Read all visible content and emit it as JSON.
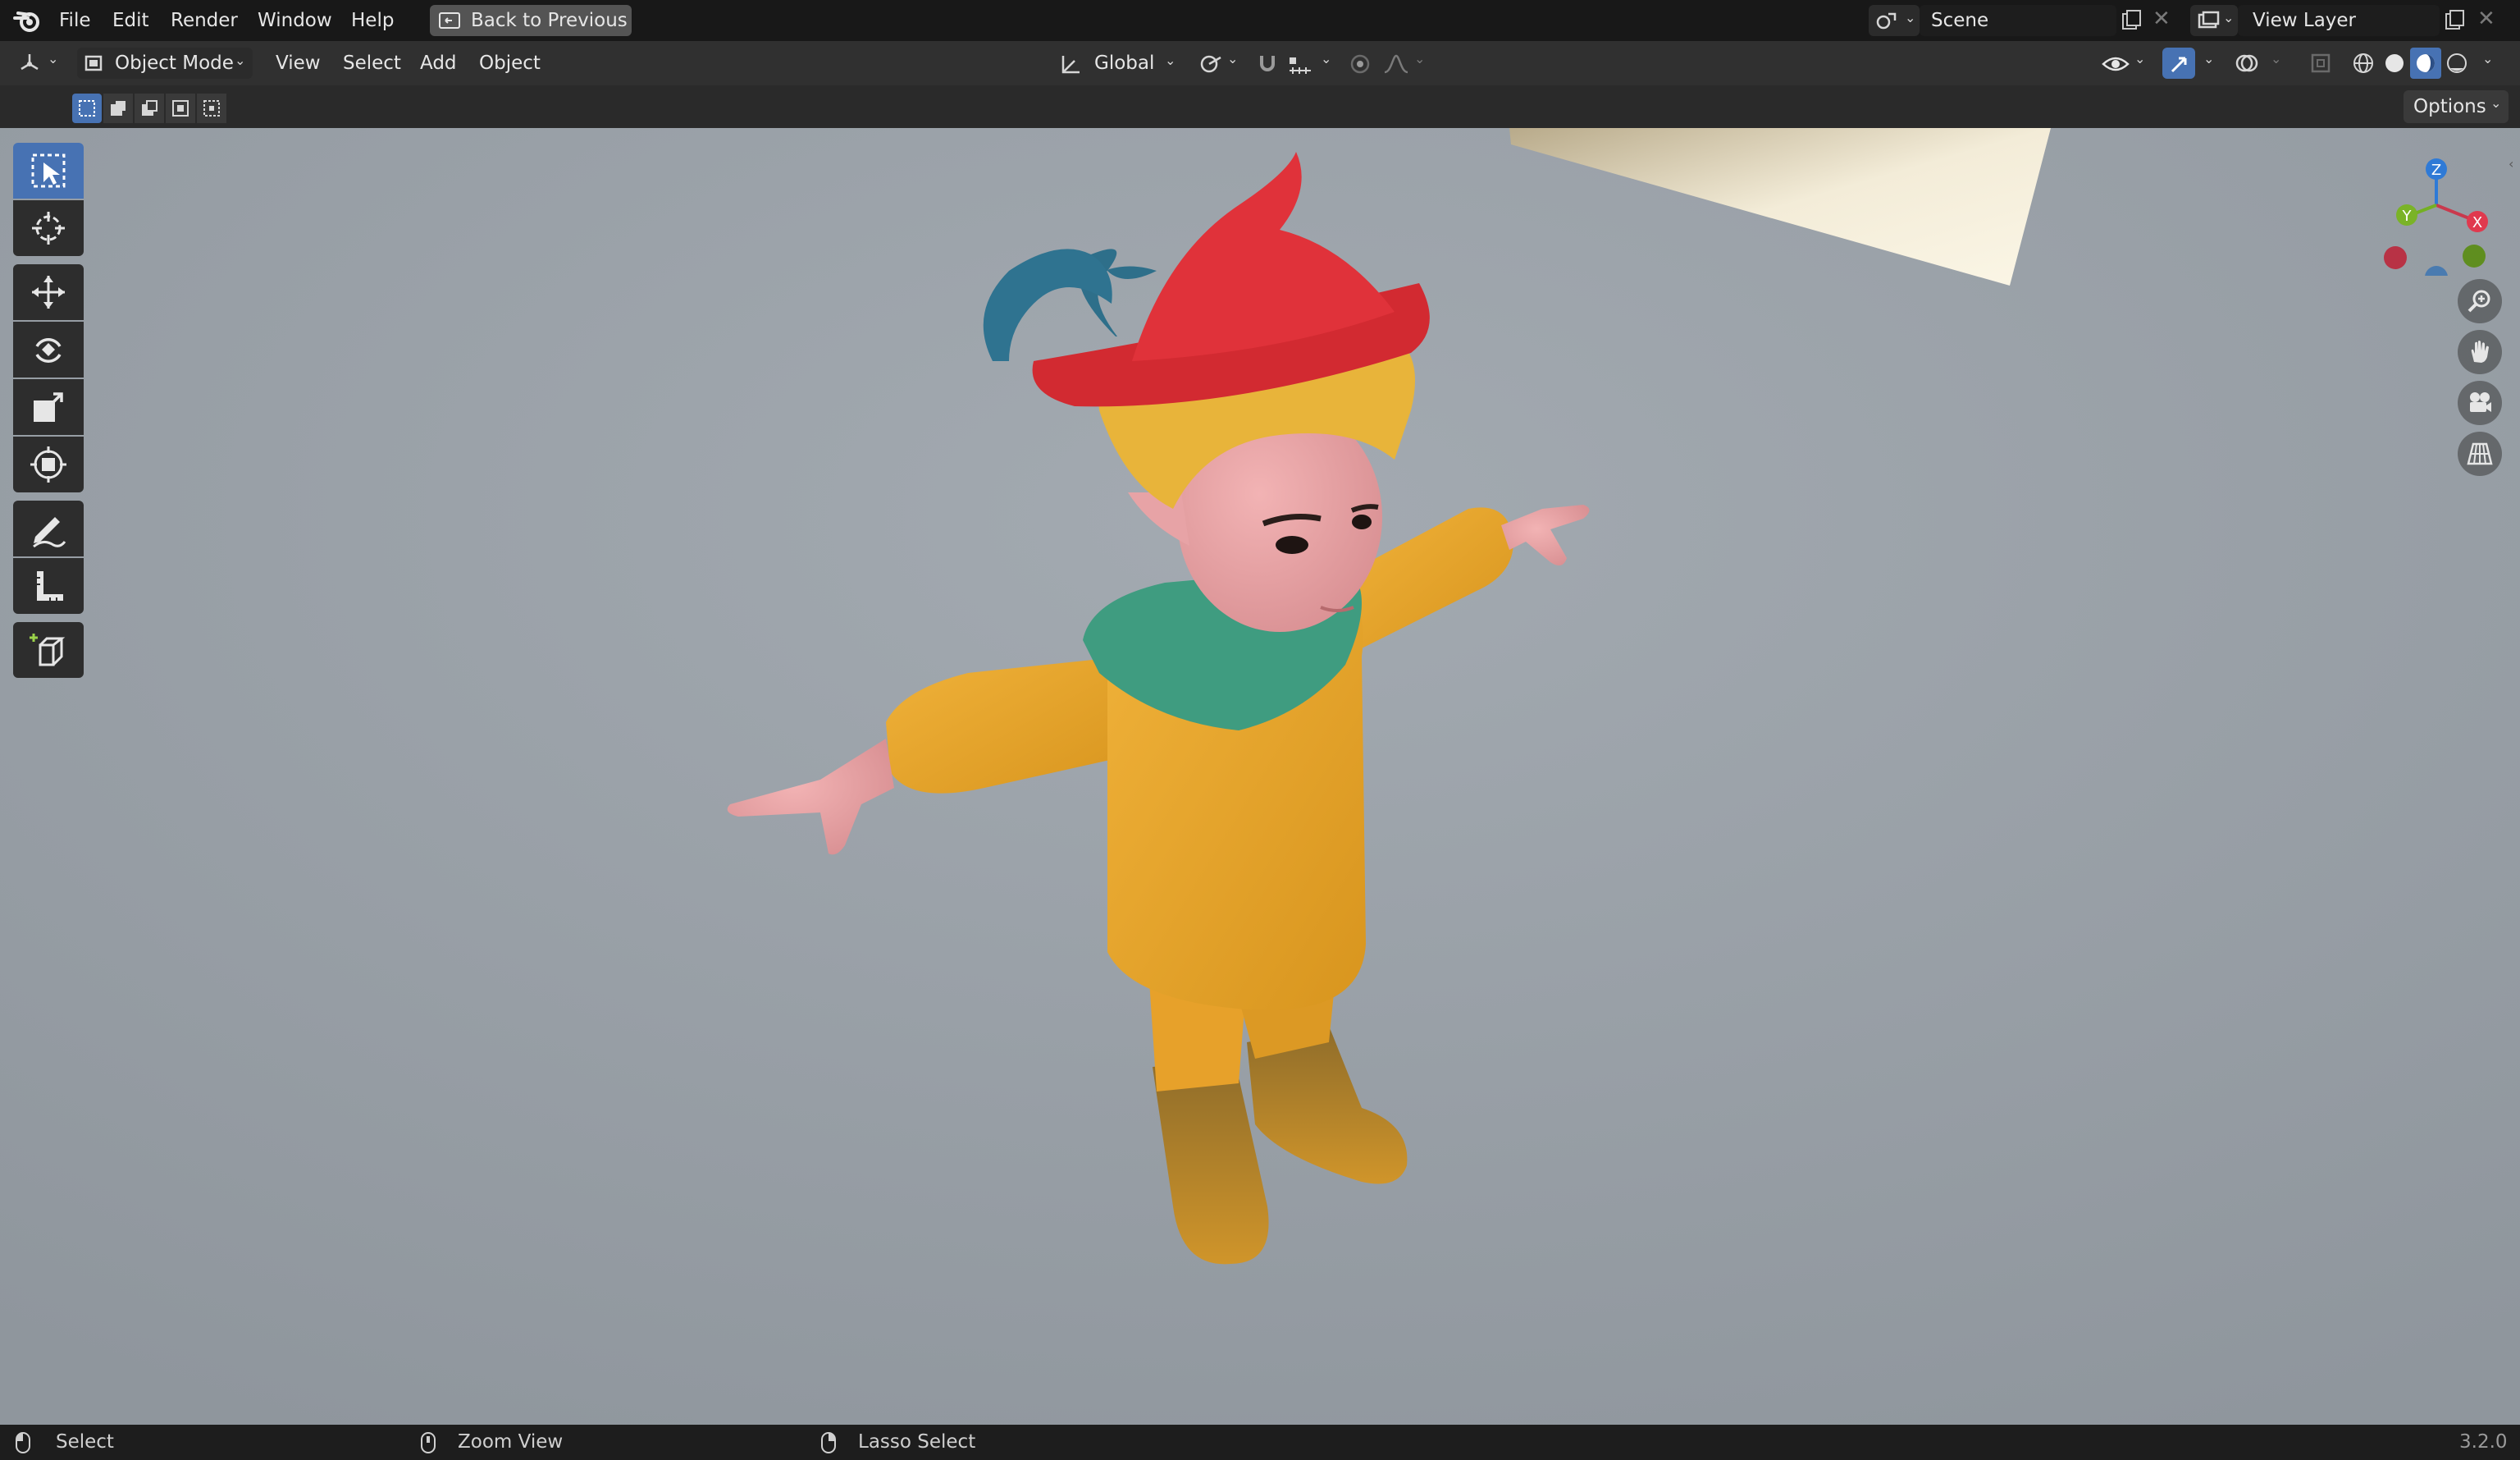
{
  "menubar": {
    "items": [
      "File",
      "Edit",
      "Render",
      "Window",
      "Help"
    ],
    "back_button": "Back to Previous",
    "scene_label": "Scene",
    "view_layer_label": "View Layer"
  },
  "viewport_header": {
    "mode": "Object Mode",
    "menus": [
      "View",
      "Select",
      "Add",
      "Object"
    ],
    "transform_orientation": "Global"
  },
  "tool_settings": {
    "options_label": "Options"
  },
  "toolbar": {
    "tools": [
      "select-box",
      "cursor",
      "move",
      "rotate",
      "scale",
      "transform",
      "annotate",
      "measure",
      "add-cube"
    ],
    "active_tool": "select-box"
  },
  "gizmo": {
    "x_label": "X",
    "y_label": "Y",
    "z_label": "Z"
  },
  "colors": {
    "accent": "#4772b3",
    "viewport_bg": "#9aa1a8",
    "axis_x": "#ff3352",
    "axis_y": "#8bdc00",
    "axis_z": "#2890ff"
  },
  "statusbar": {
    "left_action": "Select",
    "middle_action": "Zoom View",
    "right_action": "Lasso Select",
    "version": "3.2.0"
  }
}
